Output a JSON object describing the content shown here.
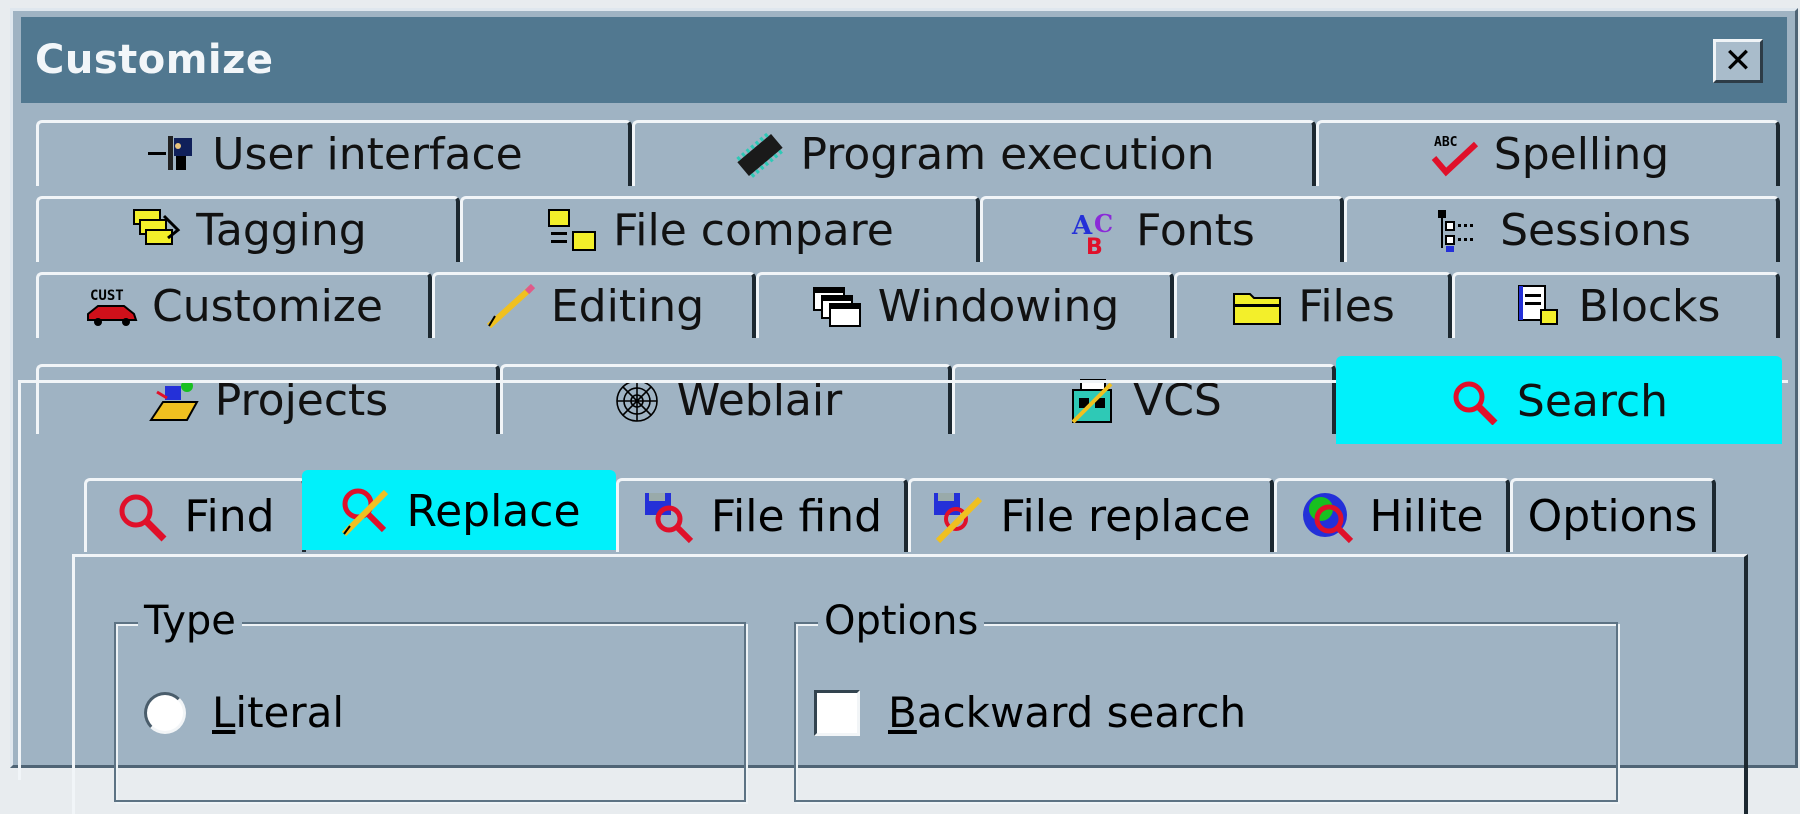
{
  "window": {
    "title": "Customize",
    "close_glyph": "✕"
  },
  "tab_rows": [
    [
      {
        "label": "User interface",
        "icon": "user-interface-icon"
      },
      {
        "label": "Program execution",
        "icon": "chip-icon"
      },
      {
        "label": "Spelling",
        "icon": "spellcheck-icon"
      }
    ],
    [
      {
        "label": "Tagging",
        "icon": "tags-icon"
      },
      {
        "label": "File compare",
        "icon": "folder-compare-icon"
      },
      {
        "label": "Fonts",
        "icon": "fonts-icon"
      },
      {
        "label": "Sessions",
        "icon": "sessions-tree-icon"
      }
    ],
    [
      {
        "label": "Customize",
        "icon": "custom-car-icon"
      },
      {
        "label": "Editing",
        "icon": "pencil-icon"
      },
      {
        "label": "Windowing",
        "icon": "windows-icon"
      },
      {
        "label": "Files",
        "icon": "folder-icon"
      },
      {
        "label": "Blocks",
        "icon": "blocks-icon"
      }
    ],
    [
      {
        "label": "Projects",
        "icon": "projects-icon"
      },
      {
        "label": "Weblair",
        "icon": "spider-web-icon"
      },
      {
        "label": "VCS",
        "icon": "vcs-icon"
      },
      {
        "label": "Search",
        "icon": "magnifier-icon",
        "selected": true
      }
    ]
  ],
  "subtabs": [
    {
      "label": "Find",
      "icon": "magnifier-icon"
    },
    {
      "label": "Replace",
      "icon": "replace-icon",
      "selected": true
    },
    {
      "label": "File find",
      "icon": "file-find-icon"
    },
    {
      "label": "File replace",
      "icon": "file-replace-icon"
    },
    {
      "label": "Hilite",
      "icon": "hilite-icon"
    },
    {
      "label": "Options",
      "icon": ""
    }
  ],
  "type_group": {
    "legend": "Type",
    "first_option": {
      "accel": "L",
      "rest": "iteral"
    }
  },
  "options_group": {
    "legend": "Options",
    "first_option": {
      "accel": "B",
      "rest": "ackward search"
    }
  },
  "colors": {
    "dialog_bg": "#9fb3c3",
    "titlebar": "#517890",
    "selected_tab": "#00f1fb"
  }
}
